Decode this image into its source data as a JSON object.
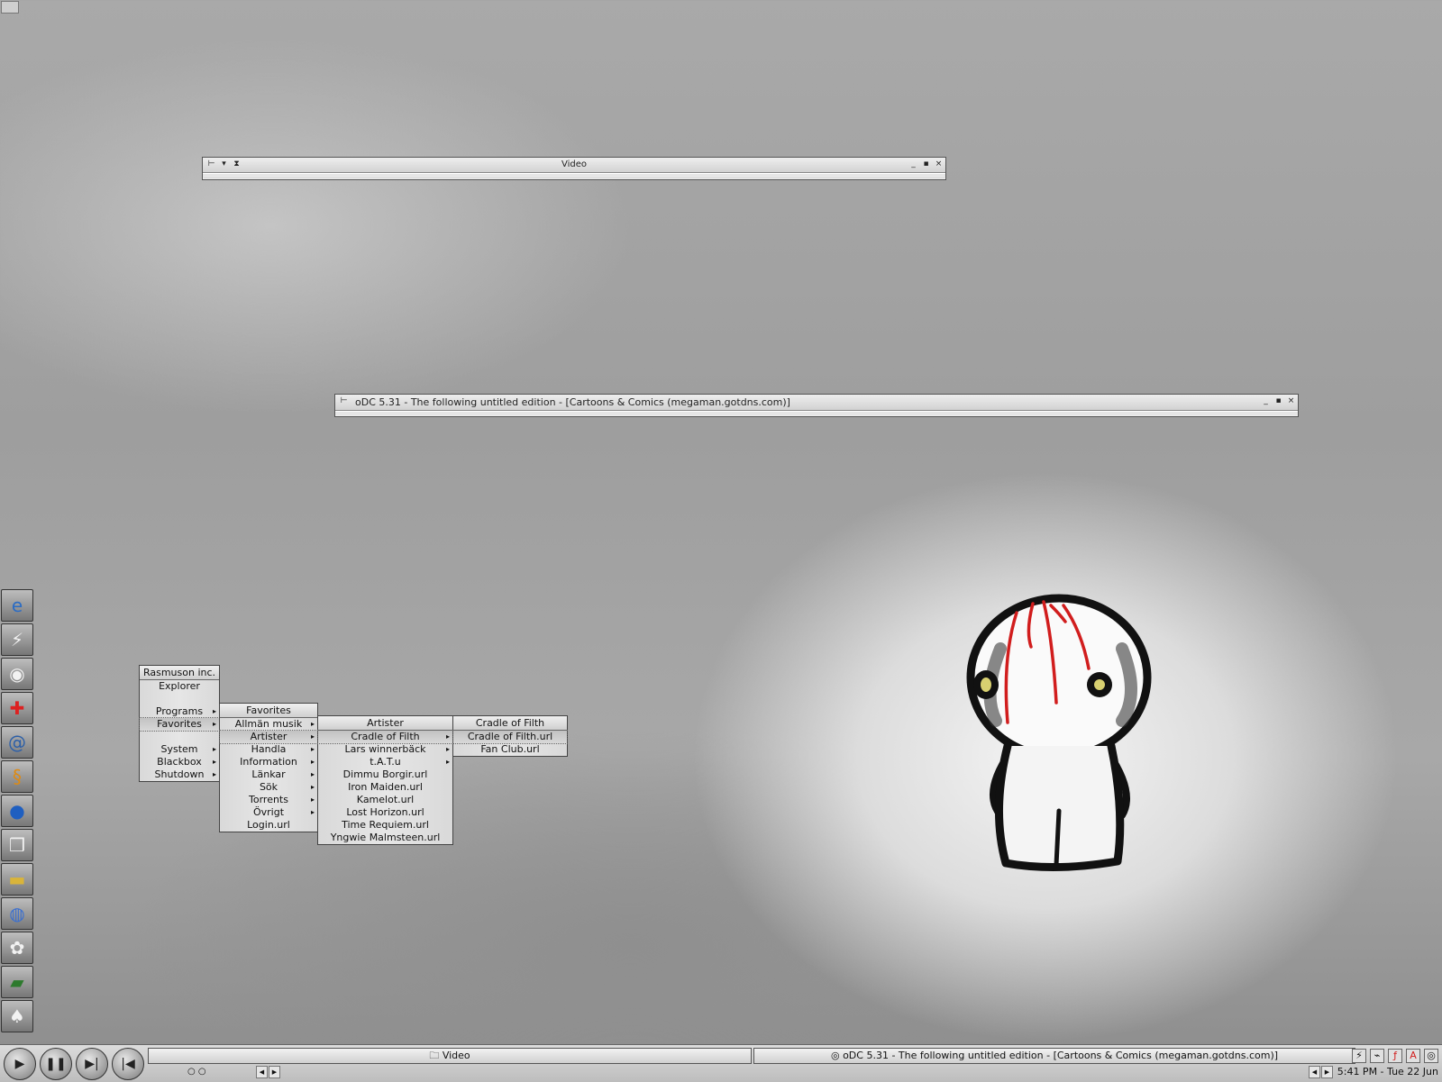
{
  "windows": {
    "video": {
      "title": "Video"
    },
    "odc": {
      "title": "oDC 5.31 - The following untitled edition - [Cartoons & Comics (megaman.gotdns.com)]"
    }
  },
  "dock_icons": [
    "internet-explorer-icon",
    "winamp-icon",
    "eye-icon",
    "red-cross-icon",
    "blue-swirl-icon",
    "orange-swirl-icon",
    "globe-icon",
    "documents-icon",
    "drive-icon",
    "network-folder-icon",
    "media-folder-icon",
    "green-folder-icon",
    "cards-folder-icon"
  ],
  "root_menu": {
    "title": "Rasmuson inc.",
    "items": [
      "Explorer",
      "Programs",
      "Favorites",
      "System",
      "Blackbox",
      "Shutdown"
    ]
  },
  "favorites_menu": {
    "title": "Favorites",
    "items": [
      "Allmän musik",
      "Artister",
      "Handla",
      "Information",
      "Länkar",
      "Sök",
      "Torrents",
      "Övrigt",
      "Login.url"
    ]
  },
  "artister_menu": {
    "title": "Artister",
    "items": [
      "Cradle of Filth",
      "Lars winnerbäck",
      "t.A.T.u",
      "Dimmu Borgir.url",
      "Iron Maiden.url",
      "Kamelot.url",
      "Lost Horizon.url",
      "Time Requiem.url",
      "Yngwie Malmsteen.url"
    ]
  },
  "cof_menu": {
    "title": "Cradle of Filth",
    "items": [
      "Cradle of Filth.url",
      "Fan Club.url"
    ]
  },
  "taskbar": {
    "tasks": [
      "Video",
      "oDC 5.31 - The following untitled edition - [Cartoons & Comics (megaman.gotdns.com)]"
    ],
    "workspace_indicator": "○ ○",
    "clock": "5:41 PM - Tue 22 Jun"
  },
  "colors": {
    "accent_red": "#d11d1d"
  }
}
